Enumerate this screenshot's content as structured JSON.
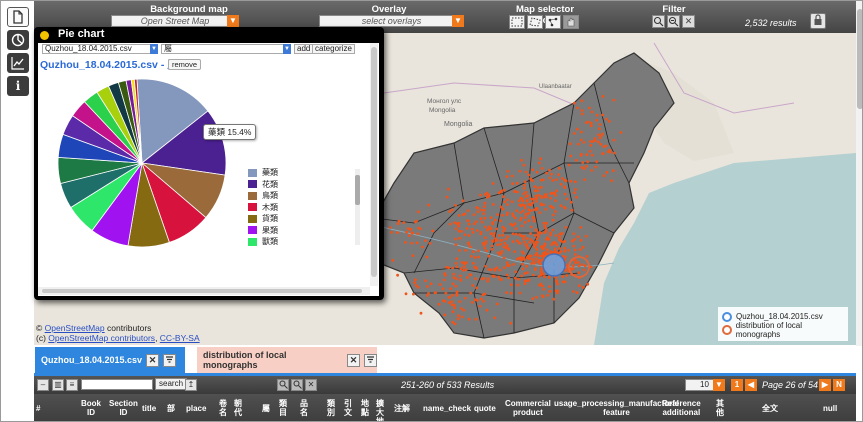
{
  "left_tools": [
    {
      "name": "document-icon",
      "glyph": "🗎"
    },
    {
      "name": "pie-chart-icon",
      "glyph": "◔"
    },
    {
      "name": "line-chart-icon",
      "glyph": "⌇"
    },
    {
      "name": "info-icon",
      "glyph": "i"
    }
  ],
  "topbar": {
    "background_map_label": "Background map",
    "background_map_value": "Open Street Map",
    "overlay_label": "Overlay",
    "overlay_placeholder": "select overlays",
    "selector_tools_label": "Map selector tools",
    "filter_label": "Filter",
    "results": "2,532 results"
  },
  "map": {
    "attribution_prefix": "© ",
    "osm_link": "OpenStreetMap",
    "attribution_middle": " contributors",
    "attribution_line2a": "(c) ",
    "osm_link2": "OpenStreetMap contributors",
    "attribution_sep": ", ",
    "license_link": "CC-BY-SA",
    "legend": [
      {
        "label": "Quzhou_18.04.2015.csv",
        "color": "#4a8fe0"
      },
      {
        "label": "distribution of local monographs",
        "color": "#e06a3b"
      }
    ],
    "labels": [
      {
        "text": "Mongolia"
      },
      {
        "text": "Ulaanbaatar"
      },
      {
        "text": "Монгол улс"
      },
      {
        "text": "Mongolia"
      }
    ]
  },
  "pie_panel": {
    "title": "Pie chart",
    "file_select": "Quzhou_18.04.2015.csv",
    "category_select": "屬",
    "add_label": "add",
    "categorize_label": "categorize",
    "subtitle": "Quzhou_18.04.2015.csv - 屬",
    "remove_label": "remove",
    "tooltip": "藥類 15.4%"
  },
  "chart_data": {
    "type": "pie",
    "title": "Quzhou_18.04.2015.csv - 屬",
    "slices": [
      {
        "label": "藥類",
        "value": 15.4,
        "color": "#8497bd"
      },
      {
        "label": "花類",
        "value": 13.0,
        "color": "#4b2090"
      },
      {
        "label": "鳥類",
        "value": 9.0,
        "color": "#9a6a3a"
      },
      {
        "label": "木類",
        "value": 8.5,
        "color": "#d7123c"
      },
      {
        "label": "貨類",
        "value": 8.0,
        "color": "#866a12"
      },
      {
        "label": "果類",
        "value": 7.5,
        "color": "#a012f0"
      },
      {
        "label": "獸類",
        "value": 6.0,
        "color": "#2ee66a"
      },
      {
        "label": "",
        "value": 5.0,
        "color": "#1e6f6a"
      },
      {
        "label": "",
        "value": 5.0,
        "color": "#1d7a44"
      },
      {
        "label": "",
        "value": 4.5,
        "color": "#1f46b8"
      },
      {
        "label": "",
        "value": 4.0,
        "color": "#5a2aa8"
      },
      {
        "label": "",
        "value": 3.5,
        "color": "#c4128a"
      },
      {
        "label": "",
        "value": 3.0,
        "color": "#2bd14a"
      },
      {
        "label": "",
        "value": 2.5,
        "color": "#a8d00c"
      },
      {
        "label": "",
        "value": 2.0,
        "color": "#123a44"
      },
      {
        "label": "",
        "value": 1.5,
        "color": "#3a5a10"
      },
      {
        "label": "",
        "value": 1.0,
        "color": "#7a1a9a"
      },
      {
        "label": "",
        "value": 0.6,
        "color": "#f2e01a"
      },
      {
        "label": "",
        "value": 0.5,
        "color": "#c0202a"
      }
    ]
  },
  "tabs": [
    {
      "label": "Quzhou_18.04.2015.csv",
      "bg": "#2e86de",
      "color": "#ffffff"
    },
    {
      "label": "distribution of local monographs",
      "bg": "#f7cfc4",
      "color": "#333333"
    }
  ],
  "table_controls": {
    "search_label": "search",
    "results_text": "251-260 of 533 Results",
    "rows_value": "10",
    "prev_label": "1",
    "page_text": "Page 26 of 54",
    "next_label": "N"
  },
  "columns": [
    {
      "label": "#"
    },
    {
      "label": "Book\nID"
    },
    {
      "label": "Section\nID"
    },
    {
      "label": "title"
    },
    {
      "label": "部"
    },
    {
      "label": "place"
    },
    {
      "label": "卷\n名"
    },
    {
      "label": "朝\n代"
    },
    {
      "label": "屬"
    },
    {
      "label": "類\n目"
    },
    {
      "label": "品\n名"
    },
    {
      "label": "類\n別"
    },
    {
      "label": "引\n文"
    },
    {
      "label": "地\n點"
    },
    {
      "label": "擴\n大\n地"
    },
    {
      "label": "注解"
    },
    {
      "label": "name_check"
    },
    {
      "label": "quote"
    },
    {
      "label": "Commercial\nproduct"
    },
    {
      "label": "usage_processing_manufactural\nfeature"
    },
    {
      "label": "Reference\nadditional"
    },
    {
      "label": "其\n他"
    },
    {
      "label": "全文"
    },
    {
      "label": "null"
    }
  ]
}
